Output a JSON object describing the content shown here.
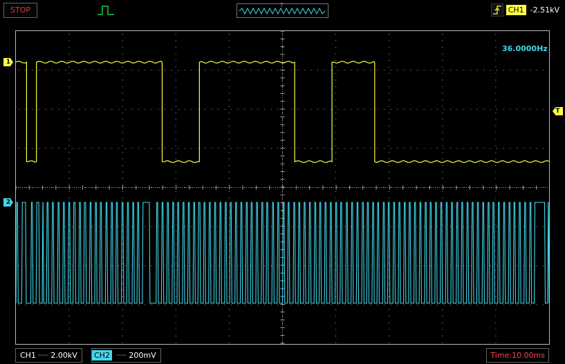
{
  "status": {
    "run_state": "STOP"
  },
  "trigger": {
    "channel": "CH1",
    "level": "-2.51kV",
    "marker": "T",
    "slope": "rising-edge-icon",
    "mode": "pulse-icon"
  },
  "timeline": {
    "marker": "T"
  },
  "measure": {
    "frequency": "36.0000Hz"
  },
  "channels": [
    {
      "label": "CH1",
      "marker": "1",
      "coupling": "----",
      "scale": "2.00kV",
      "color": "#ffff44"
    },
    {
      "label": "CH2",
      "marker": "2",
      "coupling": "----",
      "scale": "200mV",
      "color": "#40d8ec"
    }
  ],
  "timebase": {
    "label": "Time:",
    "scale": "10.00ms"
  },
  "colors": {
    "grid": "#aaaaaa",
    "frame": "#bbbbbb",
    "stop": "#ee3333",
    "time": "#ff4444"
  },
  "chart_data": {
    "type": "line",
    "xlabel": "",
    "ylabel": "",
    "x_unit": "ms",
    "xlim": [
      0,
      140
    ],
    "series": [
      {
        "name": "CH1",
        "high_kV": 2.0,
        "low_kV": -3.8,
        "transitions_ms": [
          2.8,
          5.4,
          38.4,
          48.2,
          73.2,
          83.0,
          94.2
        ],
        "initial_level": "high"
      },
      {
        "name": "CH2",
        "high_mV": 200,
        "low_mV": -400,
        "pulses_ms": [
          [
            0.0,
            0.6
          ],
          [
            1.5,
            2.7
          ],
          [
            3.9,
            4.5
          ],
          [
            5.3,
            6.2
          ],
          [
            6.9,
            7.3
          ],
          [
            8.0,
            8.6
          ],
          [
            9.4,
            10.0
          ],
          [
            10.9,
            11.5
          ],
          [
            12.3,
            12.9
          ],
          [
            13.7,
            14.3
          ],
          [
            15.0,
            15.7
          ],
          [
            16.5,
            17.1
          ],
          [
            17.8,
            18.5
          ],
          [
            19.3,
            19.9
          ],
          [
            20.7,
            21.3
          ],
          [
            22.0,
            22.6
          ],
          [
            23.5,
            24.1
          ],
          [
            24.9,
            25.5
          ],
          [
            26.2,
            26.8
          ],
          [
            27.7,
            28.3
          ],
          [
            29.1,
            29.7
          ],
          [
            30.5,
            31.1
          ],
          [
            31.8,
            32.4
          ],
          [
            33.2,
            35.2
          ],
          [
            36.8,
            37.4
          ],
          [
            38.2,
            38.8
          ],
          [
            39.6,
            40.2
          ],
          [
            41.0,
            41.6
          ],
          [
            42.3,
            42.9
          ],
          [
            43.7,
            44.3
          ],
          [
            45.1,
            45.7
          ],
          [
            46.5,
            47.1
          ],
          [
            47.8,
            48.5
          ],
          [
            49.2,
            49.8
          ],
          [
            50.6,
            51.2
          ],
          [
            52.0,
            52.6
          ],
          [
            53.4,
            54.0
          ],
          [
            54.8,
            55.4
          ],
          [
            56.1,
            56.7
          ],
          [
            57.5,
            58.1
          ],
          [
            58.9,
            59.5
          ],
          [
            60.3,
            60.9
          ],
          [
            61.6,
            62.2
          ],
          [
            63.0,
            63.6
          ],
          [
            64.4,
            65.0
          ],
          [
            65.7,
            66.3
          ],
          [
            67.2,
            67.8
          ],
          [
            68.6,
            69.2
          ],
          [
            70.0,
            70.6
          ],
          [
            71.3,
            71.9
          ],
          [
            72.8,
            73.4
          ],
          [
            74.1,
            74.7
          ],
          [
            75.5,
            76.1
          ],
          [
            76.9,
            77.5
          ],
          [
            78.3,
            78.9
          ],
          [
            79.6,
            80.2
          ],
          [
            81.0,
            81.6
          ],
          [
            82.4,
            83.0
          ],
          [
            83.8,
            84.4
          ],
          [
            85.1,
            85.7
          ],
          [
            86.6,
            87.2
          ],
          [
            88.0,
            88.6
          ],
          [
            89.4,
            90.0
          ],
          [
            90.8,
            91.4
          ],
          [
            92.1,
            92.7
          ],
          [
            93.5,
            94.1
          ],
          [
            94.8,
            95.4
          ],
          [
            96.3,
            96.9
          ],
          [
            97.6,
            98.2
          ],
          [
            99.0,
            99.6
          ],
          [
            100.4,
            101.0
          ],
          [
            101.8,
            102.4
          ],
          [
            103.1,
            103.7
          ],
          [
            104.5,
            105.1
          ],
          [
            105.9,
            106.5
          ],
          [
            107.3,
            107.9
          ],
          [
            108.6,
            109.2
          ],
          [
            110.0,
            110.6
          ],
          [
            111.4,
            112.0
          ],
          [
            112.8,
            113.4
          ],
          [
            114.2,
            114.8
          ],
          [
            115.6,
            116.2
          ],
          [
            116.9,
            117.5
          ],
          [
            118.3,
            118.9
          ],
          [
            119.6,
            120.2
          ],
          [
            121.0,
            121.6
          ],
          [
            122.4,
            123.0
          ],
          [
            123.8,
            124.4
          ],
          [
            125.1,
            125.7
          ],
          [
            126.5,
            127.1
          ],
          [
            127.9,
            128.5
          ],
          [
            129.3,
            129.9
          ],
          [
            130.6,
            131.2
          ],
          [
            132.0,
            132.6
          ],
          [
            133.4,
            134.0
          ],
          [
            134.8,
            135.4
          ],
          [
            136.1,
            139.0
          ],
          [
            139.6,
            140.0
          ]
        ]
      }
    ]
  }
}
